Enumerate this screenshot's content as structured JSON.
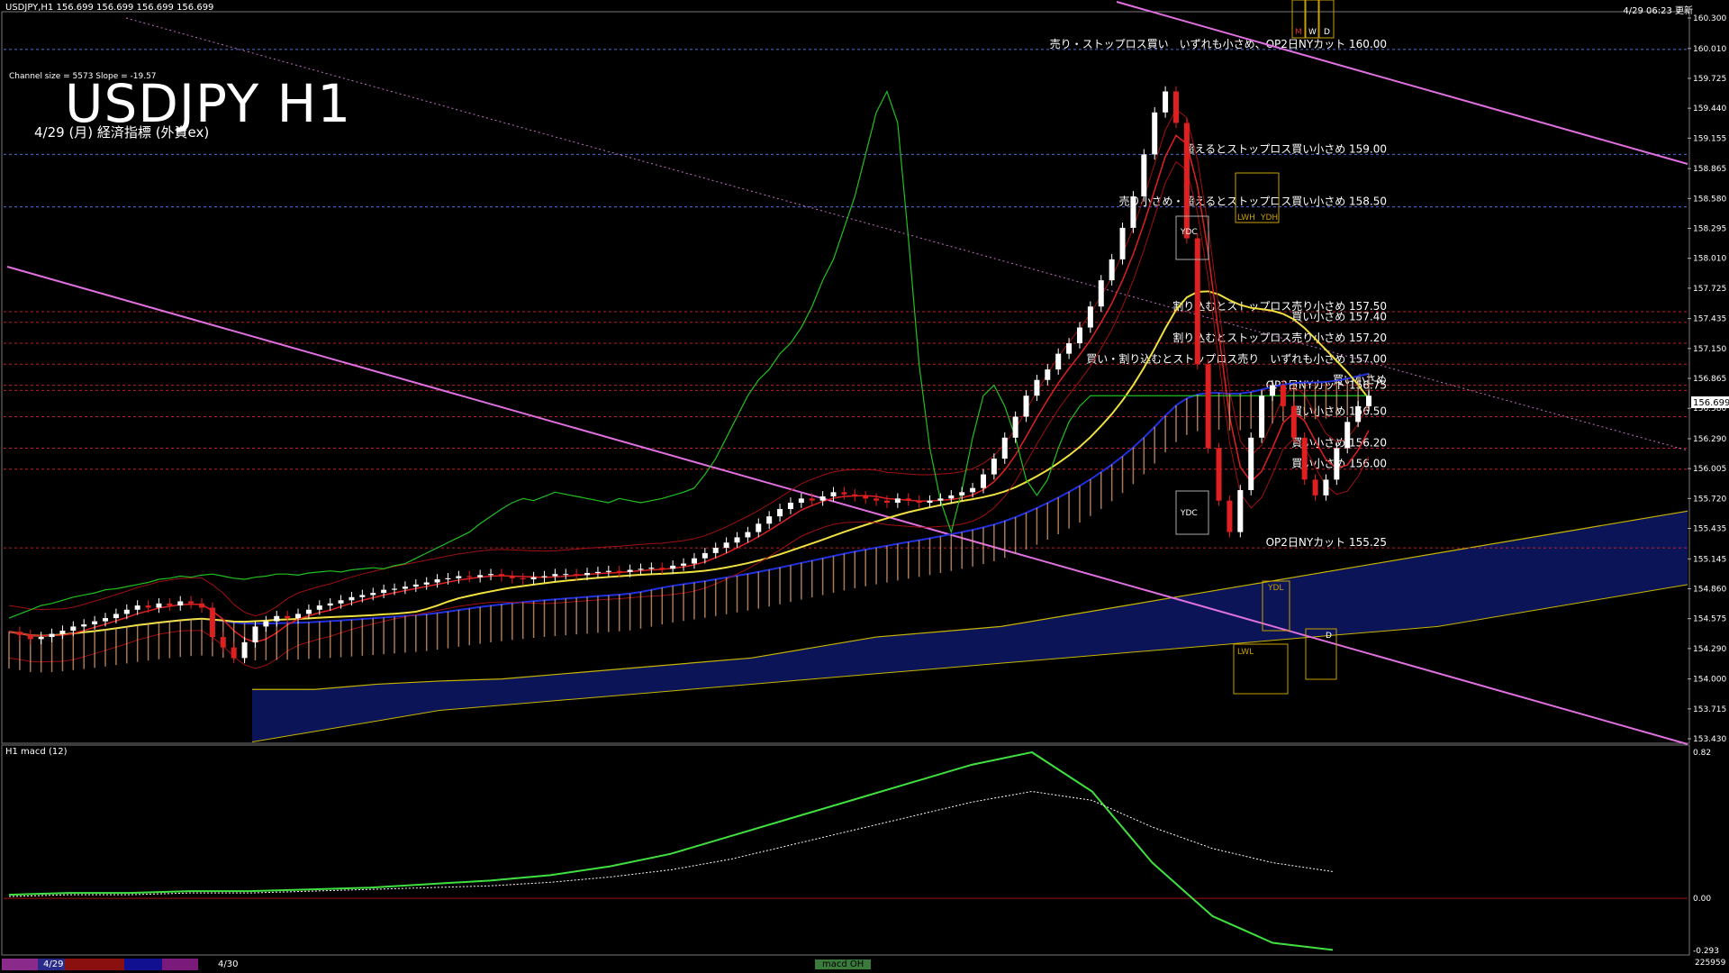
{
  "header": {
    "symbol_info": "USDJPY,H1  156.699 156.699 156.699 156.699",
    "timestamp": "4/29 06:23 更新",
    "channel_info": "Channel size = 5573 Slope = -19.57",
    "title": "USDJPY H1",
    "subtitle": "4/29 (月) 経済指標 (外資ex)"
  },
  "macd_panel": {
    "label": "H1 macd (12)",
    "ticks": [
      "0.82",
      "0.00",
      "-0.293"
    ]
  },
  "bottom": {
    "dates": [
      "4/29",
      "4/30"
    ],
    "legend": "macd OH",
    "last_value": "225959"
  },
  "current_price": "156.699",
  "box_labels": {
    "ydc1": "YDC",
    "ydc2": "YDC",
    "lwh": "LWH",
    "ydh": "YDH",
    "ydl": "YDL",
    "lwl": "LWL",
    "m": "M",
    "w": "W",
    "d": "D",
    "d2": "D"
  },
  "chart_data": {
    "type": "candlestick",
    "symbol": "USDJPY",
    "timeframe": "H1",
    "y_axis_ticks": [
      "160.300",
      "160.010",
      "159.725",
      "159.440",
      "159.155",
      "158.865",
      "158.580",
      "158.295",
      "158.010",
      "157.725",
      "157.435",
      "157.150",
      "156.865",
      "156.580",
      "156.290",
      "156.005",
      "155.720",
      "155.435",
      "155.145",
      "154.860",
      "154.575",
      "154.290",
      "154.000",
      "153.715",
      "153.430"
    ],
    "ylim": [
      153.43,
      160.3
    ],
    "level_lines": [
      {
        "price": 160.0,
        "label": "売り・ストップロス買い　いずれも小さめ、OP2日NYカット 160.00",
        "color": "#4d6fd6"
      },
      {
        "price": 159.0,
        "label": "超えるとストップロス買い小さめ 159.00",
        "color": "#4d6fd6"
      },
      {
        "price": 158.5,
        "label": "売り小さめ・超えるとストップロス買い小さめ 158.50",
        "color": "#4d6fd6"
      },
      {
        "price": 157.5,
        "label": "割り込むとストップロス売り小さめ 157.50",
        "color": "#c02020"
      },
      {
        "price": 157.4,
        "label": "買い小さめ 157.40",
        "color": "#c02020"
      },
      {
        "price": 157.2,
        "label": "割り込むとストップロス売り小さめ 157.20",
        "color": "#c02020"
      },
      {
        "price": 157.0,
        "label": "買い・割り込むとストップロス売り　いずれも小さめ 157.00",
        "color": "#c02020"
      },
      {
        "price": 156.8,
        "label": "買い小さめ",
        "color": "#c02020"
      },
      {
        "price": 156.75,
        "label": "OP2日NYカット 156.75",
        "color": "#c02020"
      },
      {
        "price": 156.5,
        "label": "買い小さめ 156.50",
        "color": "#c02020"
      },
      {
        "price": 156.2,
        "label": "買い小さめ 156.20",
        "color": "#c02020"
      },
      {
        "price": 156.0,
        "label": "買い小さめ 156.00",
        "color": "#c02020"
      },
      {
        "price": 155.25,
        "label": "OP2日NYカット 155.25",
        "color": "#c02020"
      }
    ],
    "close_series": [
      154.45,
      154.42,
      154.38,
      154.4,
      154.43,
      154.46,
      154.5,
      154.52,
      154.55,
      154.58,
      154.62,
      154.66,
      154.7,
      154.68,
      154.72,
      154.7,
      154.74,
      154.72,
      154.68,
      154.4,
      154.3,
      154.2,
      154.35,
      154.5,
      154.55,
      154.6,
      154.58,
      154.62,
      154.66,
      154.7,
      154.72,
      154.75,
      154.78,
      154.8,
      154.82,
      154.85,
      154.86,
      154.88,
      154.9,
      154.92,
      154.95,
      154.96,
      154.98,
      154.97,
      154.99,
      155.0,
      154.98,
      154.96,
      154.95,
      154.97,
      154.98,
      155.0,
      155.0,
      154.99,
      155.01,
      155.02,
      155.03,
      155.02,
      155.04,
      155.05,
      155.06,
      155.05,
      155.08,
      155.1,
      155.15,
      155.2,
      155.25,
      155.3,
      155.35,
      155.4,
      155.48,
      155.55,
      155.62,
      155.68,
      155.72,
      155.7,
      155.74,
      155.78,
      155.76,
      155.74,
      155.72,
      155.7,
      155.68,
      155.72,
      155.7,
      155.68,
      155.7,
      155.72,
      155.75,
      155.78,
      155.82,
      155.95,
      156.1,
      156.3,
      156.5,
      156.7,
      156.85,
      156.95,
      157.1,
      157.2,
      157.35,
      157.55,
      157.8,
      158.0,
      158.3,
      158.6,
      159.0,
      159.4,
      159.6,
      159.3,
      158.2,
      157.0,
      156.2,
      155.7,
      155.4,
      155.8,
      156.3,
      156.7,
      156.8,
      156.6,
      156.3,
      155.9,
      155.75,
      155.9,
      156.2,
      156.45,
      156.6,
      156.7
    ],
    "ichimoku_cloud": {
      "span_a": [
        153.9,
        153.9,
        153.95,
        153.98,
        154.0,
        154.05,
        154.1,
        154.15,
        154.2,
        154.3,
        154.4,
        154.45,
        154.5,
        154.6,
        154.7,
        154.8,
        154.9,
        155.0,
        155.1,
        155.2,
        155.3,
        155.4,
        155.5,
        155.6
      ],
      "span_b": [
        153.4,
        153.5,
        153.6,
        153.7,
        153.75,
        153.8,
        153.85,
        153.9,
        153.95,
        154.0,
        154.05,
        154.1,
        154.15,
        154.2,
        154.25,
        154.3,
        154.35,
        154.4,
        154.45,
        154.5,
        154.6,
        154.7,
        154.8,
        154.9
      ]
    },
    "macd": {
      "line": [
        0.02,
        0.03,
        0.03,
        0.04,
        0.04,
        0.05,
        0.06,
        0.08,
        0.1,
        0.13,
        0.18,
        0.25,
        0.35,
        0.45,
        0.55,
        0.65,
        0.75,
        0.82,
        0.6,
        0.2,
        -0.1,
        -0.25,
        -0.29
      ],
      "signal": [
        0.01,
        0.02,
        0.02,
        0.03,
        0.03,
        0.04,
        0.05,
        0.06,
        0.07,
        0.09,
        0.12,
        0.16,
        0.22,
        0.3,
        0.38,
        0.46,
        0.54,
        0.6,
        0.55,
        0.4,
        0.28,
        0.2,
        0.15
      ]
    },
    "macd_ylim": [
      -0.293,
      0.82
    ]
  }
}
